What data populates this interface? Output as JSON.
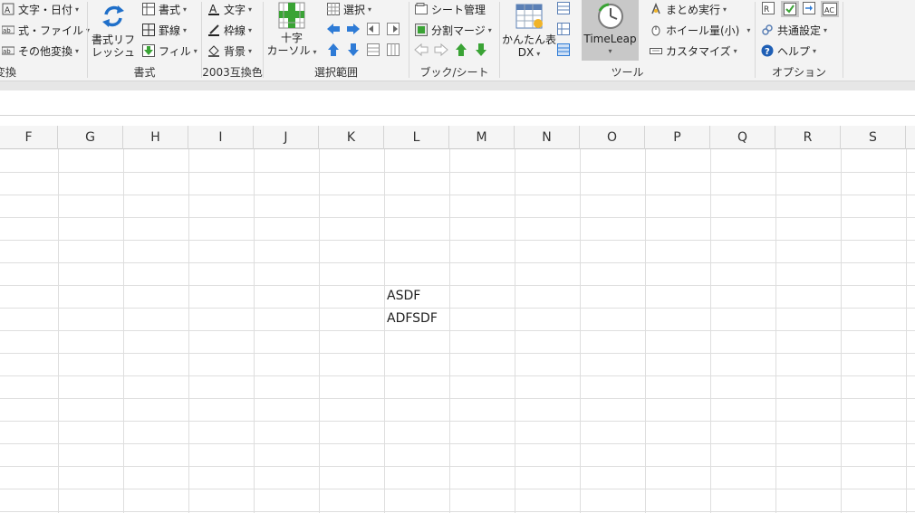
{
  "ribbon": {
    "conv_group": {
      "items": [
        "文字・日付",
        "式・ファイル",
        "その他変換"
      ],
      "label": "変換"
    },
    "refresh_group": {
      "big_label_1": "書式リフ",
      "big_label_2": "レッシュ",
      "items": [
        "書式",
        "罫線",
        "フィル"
      ],
      "label": "書式"
    },
    "color_group": {
      "items": [
        "文字",
        "枠線",
        "背景"
      ],
      "label": "2003互換色"
    },
    "select_group": {
      "big_label_1": "十字",
      "big_label_2": "カーソル",
      "select_label": "選択",
      "label": "選択範囲"
    },
    "book_group": {
      "items": [
        "シート管理",
        "分割マージ"
      ],
      "label": "ブック/シート"
    },
    "tool_group": {
      "kantan_1": "かんたん表",
      "kantan_2": "DX",
      "timeleap": "TimeLeap",
      "items": [
        "まとめ実行",
        "ホイール量(小)",
        "カスタマイズ"
      ],
      "label": "ツール"
    },
    "option_group": {
      "items": [
        "共通設定",
        "ヘルプ"
      ],
      "label": "オプション"
    }
  },
  "columns": [
    "F",
    "G",
    "H",
    "I",
    "J",
    "K",
    "L",
    "M",
    "N",
    "O",
    "P",
    "Q",
    "R",
    "S"
  ],
  "cells": [
    {
      "ref": "L7",
      "value": "ASDF"
    },
    {
      "ref": "L8",
      "value": "ADFSDF"
    }
  ],
  "colors": {
    "ribbon_bg": "#f3f3f3",
    "selected_button": "#c8c8c8",
    "blue_arrow": "#2e7bd6",
    "green_arrow": "#3aa335",
    "grid_line": "#dedede"
  }
}
